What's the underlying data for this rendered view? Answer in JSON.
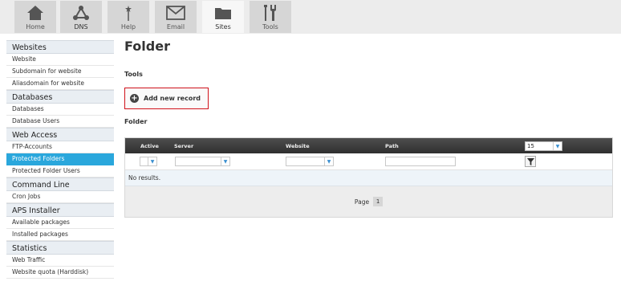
{
  "topnav": {
    "tabs": [
      {
        "label": "Home",
        "icon": "home-icon"
      },
      {
        "label": "DNS",
        "icon": "dns-network-icon"
      },
      {
        "label": "Help",
        "icon": "help-wand-icon"
      },
      {
        "label": "Email",
        "icon": "envelope-icon"
      },
      {
        "label": "Sites",
        "icon": "folder-icon",
        "active": true
      },
      {
        "label": "Tools",
        "icon": "tools-icon"
      }
    ]
  },
  "sidebar": {
    "sections": [
      {
        "title": "Websites",
        "items": [
          "Website",
          "Subdomain for website",
          "Aliasdomain for website"
        ]
      },
      {
        "title": "Databases",
        "items": [
          "Databases",
          "Database Users"
        ]
      },
      {
        "title": "Web Access",
        "items": [
          "FTP-Accounts",
          "Protected Folders",
          "Protected Folder Users"
        ]
      },
      {
        "title": "Command Line",
        "items": [
          "Cron Jobs"
        ]
      },
      {
        "title": "APS Installer",
        "items": [
          "Available packages",
          "Installed packages"
        ]
      },
      {
        "title": "Statistics",
        "items": [
          "Web Traffic",
          "Website quota (Harddisk)"
        ]
      }
    ],
    "active_item": "Protected Folders"
  },
  "main": {
    "title": "Folder",
    "tools_label": "Tools",
    "add_button_label": "Add new record",
    "section_label": "Folder",
    "table": {
      "columns": [
        "Active",
        "Server",
        "Website",
        "Path"
      ],
      "page_size": "15",
      "empty_text": "No results.",
      "page_label": "Page",
      "current_page": "1"
    }
  },
  "colors": {
    "accent": "#2aa7dc",
    "highlight_border": "#d0121b",
    "table_header": "#3a3a3a"
  }
}
